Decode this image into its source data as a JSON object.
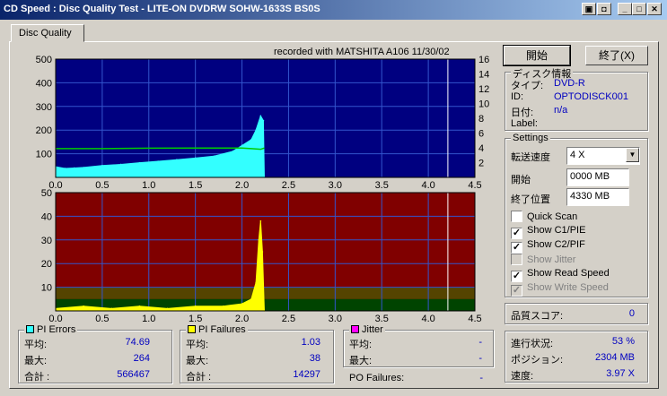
{
  "window": {
    "title": "CD Speed : Disc Quality Test - LITE-ON DVDRW SOHW-1633S BS0S"
  },
  "tabs": [
    {
      "label": "Disc Quality"
    }
  ],
  "recorded_with": "recorded with MATSHITA A106 11/30/02",
  "buttons": {
    "start": "開始",
    "exit": "終了(X)"
  },
  "disc_info": {
    "title": "ディスク情報",
    "type_label": "タイプ:",
    "type_value": "DVD-R",
    "id_label": "ID:",
    "id_value": "OPTODISCK001",
    "date_label": "日付:",
    "date_value": "n/a",
    "label_label": "Label:",
    "label_value": ""
  },
  "settings": {
    "title": "Settings",
    "speed_label": "転送速度",
    "speed_value": "4 X",
    "start_label": "開始",
    "start_value": "0000 MB",
    "end_label": "終了位置",
    "end_value": "4330 MB",
    "checkboxes": [
      {
        "label": "Quick Scan",
        "checked": false,
        "disabled": false
      },
      {
        "label": "Show C1/PIE",
        "checked": true,
        "disabled": false
      },
      {
        "label": "Show C2/PIF",
        "checked": true,
        "disabled": false
      },
      {
        "label": "Show Jitter",
        "checked": false,
        "disabled": true
      },
      {
        "label": "Show Read Speed",
        "checked": true,
        "disabled": false
      },
      {
        "label": "Show Write Speed",
        "checked": true,
        "disabled": true
      }
    ]
  },
  "quality_score": {
    "label": "品質スコア:",
    "value": "0"
  },
  "progress": {
    "progress_label": "進行状況:",
    "progress_value": "53 %",
    "position_label": "ポジション:",
    "position_value": "2304 MB",
    "speed_label": "速度:",
    "speed_value": "3.97 X"
  },
  "pi_errors": {
    "title": "PI Errors",
    "color": "#33ffff",
    "avg_label": "平均:",
    "avg": "74.69",
    "max_label": "最大:",
    "max": "264",
    "total_label": "合計 :",
    "total": "566467"
  },
  "pi_failures": {
    "title": "PI Failures",
    "color": "#ffff00",
    "avg_label": "平均:",
    "avg": "1.03",
    "max_label": "最大:",
    "max": "38",
    "total_label": "合計 :",
    "total": "14297"
  },
  "jitter": {
    "title": "Jitter",
    "color": "#ff00ff",
    "avg_label": "平均:",
    "avg": "-",
    "max_label": "最大:",
    "max": "-"
  },
  "po_failures": {
    "label": "PO Failures:",
    "value": "-"
  },
  "colors": {
    "top_bg": "#000080",
    "bottom_bg": "#800000",
    "pie": "#33ffff",
    "pif": "#ffff00",
    "speed": "#00cc00",
    "grid": "#3355cc"
  },
  "chart_data": [
    {
      "type": "area",
      "title": "",
      "x_ticks": [
        "0.0",
        "0.5",
        "1.0",
        "1.5",
        "2.0",
        "2.5",
        "3.0",
        "3.5",
        "4.0",
        "4.5"
      ],
      "y_ticks_left": [
        "500",
        "400",
        "300",
        "200",
        "100"
      ],
      "y_ticks_right": [
        "16",
        "14",
        "12",
        "10",
        "8",
        "6",
        "4",
        "2"
      ],
      "xlim": [
        0,
        4.5
      ],
      "ylim": [
        0,
        500
      ],
      "y2lim": [
        0,
        16
      ],
      "current_position": 4.21,
      "series": [
        {
          "values_x": [
            0.0,
            0.1,
            0.2,
            0.3,
            0.5,
            0.7,
            0.9,
            1.1,
            1.3,
            1.5,
            1.7,
            1.9,
            2.0,
            2.1,
            2.15,
            2.2,
            2.23,
            2.24
          ],
          "values": [
            45,
            38,
            40,
            42,
            50,
            55,
            62,
            68,
            75,
            82,
            90,
            110,
            135,
            160,
            200,
            260,
            240,
            0
          ]
        },
        {
          "values_x": [
            0.0,
            0.5,
            1.0,
            1.5,
            2.0,
            2.1,
            2.2,
            2.24
          ],
          "values": [
            3.9,
            3.9,
            3.95,
            3.97,
            3.97,
            3.9,
            3.8,
            3.97
          ]
        }
      ]
    },
    {
      "type": "bar",
      "title": "",
      "x_ticks": [
        "0.0",
        "0.5",
        "1.0",
        "1.5",
        "2.0",
        "2.5",
        "3.0",
        "3.5",
        "4.0",
        "4.5"
      ],
      "y_ticks": [
        "50",
        "40",
        "30",
        "20",
        "10"
      ],
      "xlim": [
        0,
        4.5
      ],
      "ylim": [
        0,
        50
      ],
      "current_position": 4.21,
      "series": [
        {
          "values_x": [
            0.0,
            0.3,
            0.6,
            0.9,
            1.2,
            1.5,
            1.8,
            2.0,
            2.1,
            2.15,
            2.18,
            2.2,
            2.22,
            2.24
          ],
          "values": [
            1,
            2,
            1,
            2,
            1,
            2,
            2,
            3,
            5,
            12,
            30,
            38,
            25,
            0
          ]
        }
      ]
    }
  ]
}
